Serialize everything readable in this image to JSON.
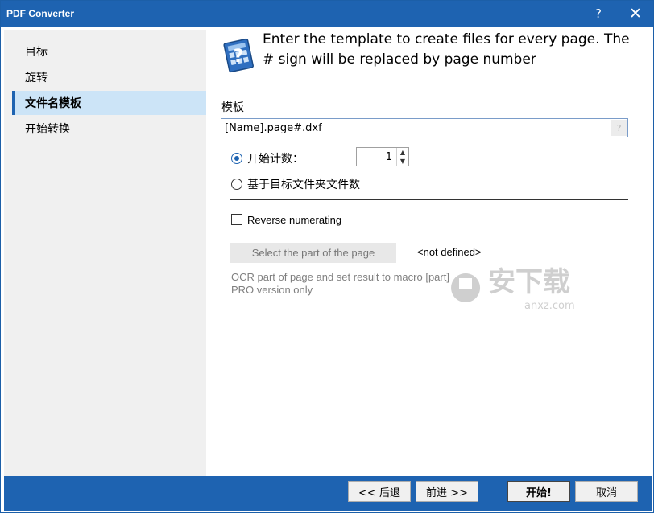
{
  "window": {
    "title": "PDF Converter",
    "help": "?",
    "close": "✕"
  },
  "sidebar": {
    "items": [
      {
        "label": "目标"
      },
      {
        "label": "旋转"
      },
      {
        "label": "文件名模板"
      },
      {
        "label": "开始转换"
      }
    ],
    "active_index": 2
  },
  "header": {
    "text": "Enter the template to create files for every page. The # sign will be replaced by page number",
    "icon": "document-template-icon"
  },
  "template": {
    "label": "模板",
    "value": "[Name].page#.dxf",
    "help": "?"
  },
  "numbering": {
    "start_count_label": "开始计数：",
    "start_count_value": "1",
    "start_count_checked": true,
    "folder_count_label": "基于目标文件夹文件数",
    "folder_count_checked": false
  },
  "reverse": {
    "label": "Reverse numerating",
    "checked": false
  },
  "part": {
    "button_label": "Select the part of the page",
    "value": "<not defined>",
    "note_line1": "OCR part of page and set result to macro [part]",
    "note_line2": "PRO version only"
  },
  "watermark": {
    "text": "安下载",
    "sub": "anxz.com"
  },
  "footer": {
    "back": "<< 后退",
    "next": "前进 >>",
    "start": "开始!",
    "cancel": "取消"
  },
  "colors": {
    "accent": "#1e63b1",
    "sidebar_bg": "#f0f0f0",
    "selected_bg": "#cce4f7"
  }
}
